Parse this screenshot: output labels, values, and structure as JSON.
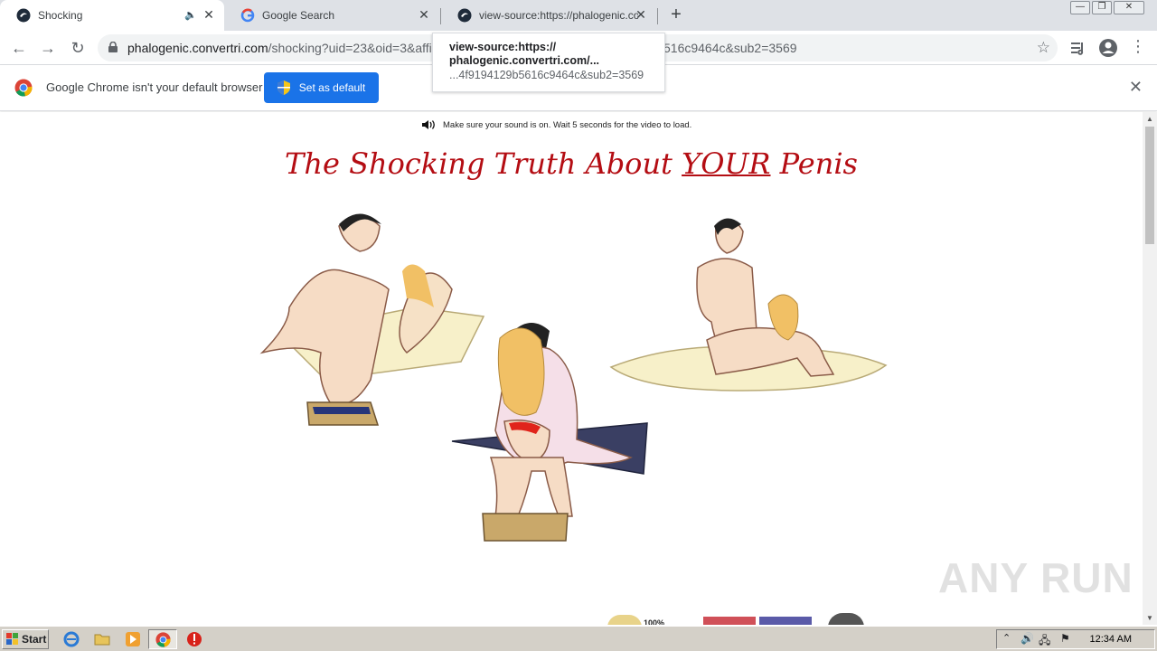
{
  "tabs": [
    {
      "title": "Shocking",
      "active": true,
      "audio": true
    },
    {
      "title": "Google Search",
      "active": false
    },
    {
      "title": "view-source:https://phalogenic.conv",
      "active": false
    }
  ],
  "toolbar": {
    "url_host": "phalogenic.convertri.com",
    "url_path": "/shocking?uid=23&oid=3&affi",
    "url_tail": "516c9464c&sub2=3569"
  },
  "tooltip": {
    "line1": "view-source:https://",
    "line2": "phalogenic.convertri.com/...",
    "line3": "...4f9194129b5616c9464c&sub2=3569"
  },
  "infobar": {
    "message": "Google Chrome isn't your default browser",
    "button": "Set as default"
  },
  "page": {
    "sound_notice": "Make sure your sound is on. Wait 5 seconds for the video to load.",
    "headline_pre": "The Shocking Truth About ",
    "headline_emph": "YOUR",
    "headline_post": " Penis",
    "watermark": "ANY RUN"
  },
  "taskbar": {
    "start": "Start",
    "clock": "12:34 AM"
  },
  "colors": {
    "headline": "#b40d13",
    "infobar_button": "#1a73e8",
    "tabstrip": "#dee1e6"
  }
}
